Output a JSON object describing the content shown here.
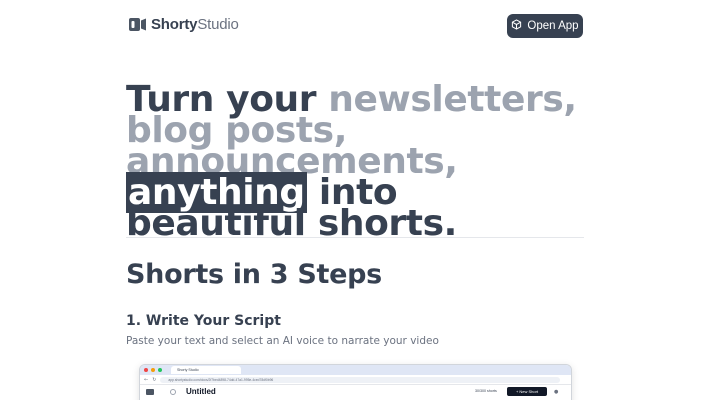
{
  "header": {
    "brand_bold": "Shorty",
    "brand_light": "Studio",
    "open_app_label": "Open App"
  },
  "hero": {
    "part1": "Turn your ",
    "part2": "newsletters, blog posts, announcements,",
    "part3": "anything",
    "part4": " into beautiful shorts."
  },
  "steps": {
    "title": "Shorts in 3 Steps",
    "step1_title": "1. Write Your Script",
    "step1_desc": "Paste your text and select an AI voice to narrate your video"
  },
  "mockup": {
    "tab_label": "Shorty Studio",
    "url": "app.shortystudio.com/docs/2f7bed4898-74dd-47a1-995e-4ced78df0b96",
    "page_title": "Untitled",
    "shorts_count": "30/300 shorts",
    "new_short_label": "+ New Short"
  },
  "colors": {
    "primary": "#374151",
    "muted": "#9ca3af",
    "background": "#ffffff"
  },
  "icons": {
    "brand": "shorty-logo-icon",
    "open_app": "cube-icon"
  }
}
